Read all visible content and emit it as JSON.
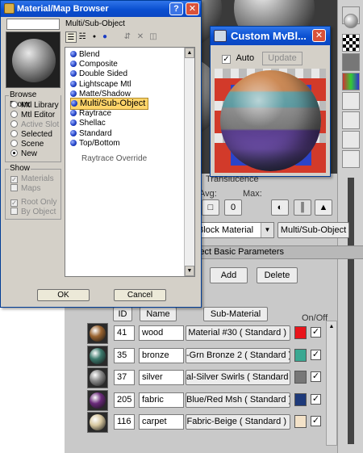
{
  "browser": {
    "title": "Material/Map Browser",
    "path_label": "Multi/Sub-Object",
    "browse_from": {
      "title": "Browse From:",
      "options": [
        {
          "label": "Mtl Library",
          "selected": false,
          "enabled": true
        },
        {
          "label": "Mtl Editor",
          "selected": false,
          "enabled": true
        },
        {
          "label": "Active Slot",
          "selected": false,
          "enabled": false
        },
        {
          "label": "Selected",
          "selected": false,
          "enabled": true
        },
        {
          "label": "Scene",
          "selected": false,
          "enabled": true
        },
        {
          "label": "New",
          "selected": true,
          "enabled": true
        }
      ]
    },
    "show": {
      "title": "Show",
      "options": [
        {
          "label": "Materials",
          "checked": true
        },
        {
          "label": "Maps",
          "checked": false
        },
        {
          "label": "Root Only",
          "checked": true
        },
        {
          "label": "By Object",
          "checked": false
        }
      ]
    },
    "items": [
      "Blend",
      "Composite",
      "Double Sided",
      "Lightscape Mtl",
      "Matte/Shadow",
      "Multi/Sub-Object",
      "Raytrace",
      "Shellac",
      "Standard",
      "Top/Bottom"
    ],
    "selected_item": "Multi/Sub-Object",
    "obscured_item": "Raytrace Override",
    "ok_label": "OK",
    "cancel_label": "Cancel",
    "help_label": "?",
    "close_label": "✕"
  },
  "mv_window": {
    "title": "Custom MvBl...",
    "auto_label": "Auto",
    "auto_checked": true,
    "update_label": "Update",
    "close_label": "✕"
  },
  "editor": {
    "translucence_label": "Translucence",
    "avg_label": "Avg:",
    "max_label": "Max:",
    "material_name": "Block Material",
    "material_type": "Multi/Sub-Object",
    "rollout_title": "ject Basic Parameters",
    "add_label": "Add",
    "delete_label": "Delete",
    "col_id": "ID",
    "col_name": "Name",
    "col_sub": "Sub-Material",
    "col_onoff": "On/Off",
    "rows": [
      {
        "id": "41",
        "name": "wood",
        "sub": "Material #30  ( Standard )",
        "swatch": "#e8141b",
        "on": true,
        "ball": "#9a6430"
      },
      {
        "id": "35",
        "name": "bronze",
        "sub": "-Grn Bronze 2  ( Standard )",
        "swatch": "#3aa892",
        "on": true,
        "ball": "#3d7a6d"
      },
      {
        "id": "37",
        "name": "silver",
        "sub": "al-Silver Swirls  ( Standard )",
        "swatch": "#777777",
        "on": true,
        "ball": "#8a8a8a"
      },
      {
        "id": "205",
        "name": "fabric",
        "sub": "Blue/Red Msh  ( Standard )",
        "swatch": "#1e3a7a",
        "on": true,
        "ball": "#6a2a7a"
      },
      {
        "id": "116",
        "name": "carpet",
        "sub": "Fabric-Beige  ( Standard )",
        "swatch": "#f3e2c8",
        "on": true,
        "ball": "#d8c8a0"
      }
    ]
  }
}
